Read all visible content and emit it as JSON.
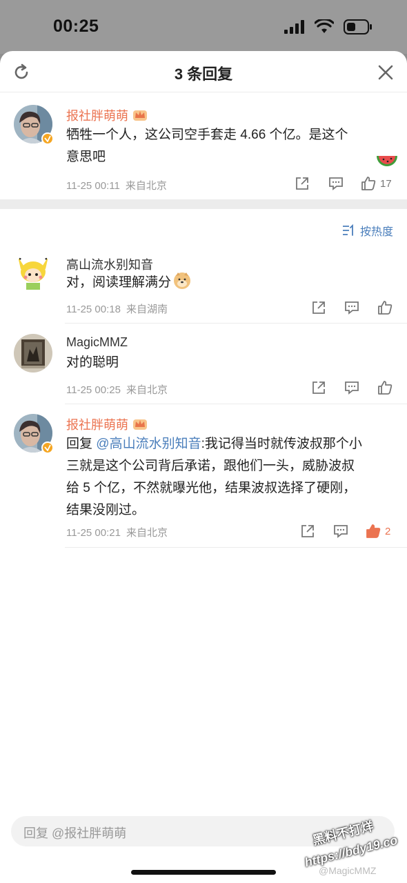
{
  "status": {
    "time": "00:25"
  },
  "header": {
    "title": "3 条回复"
  },
  "root": {
    "username": "报社胖萌萌",
    "content_line1": "牺牲一个人，这公司空手套走 4.66 个亿。是这个",
    "content_line2": "意思吧",
    "time": "11-25 00:11",
    "location": "来自北京",
    "likes": "17"
  },
  "sort": {
    "label": "按热度"
  },
  "replies": [
    {
      "username": "高山流水别知音",
      "content": "对，阅读理解满分",
      "time": "11-25 00:18",
      "location": "来自湖南"
    },
    {
      "username": "MagicMMZ",
      "content": "对的聪明",
      "time": "11-25 00:25",
      "location": "来自北京"
    },
    {
      "username": "报社胖萌萌",
      "reply_prefix": "回复 ",
      "mention": "@高山流水别知音",
      "content_line1": ":我记得当时就传波叔那个小",
      "content_line2": "三就是这个公司背后承诺，跟他们一头，威胁波叔",
      "content_line3": "给 5 个亿，不然就曝光他，结果波叔选择了硬刚，",
      "content_line4": "结果没刚过。",
      "time": "11-25 00:21",
      "location": "来自北京",
      "likes": "2"
    }
  ],
  "input": {
    "placeholder": "回复 @报社胖萌萌"
  },
  "watermark": {
    "line1": "黑料不打烊",
    "line2": "https://bdy19.co",
    "weibo": "@MagicMMZ"
  },
  "colors": {
    "accent": "#eb7350",
    "link": "#4a7ebb",
    "vip": "#f5a623"
  },
  "icons": [
    "refresh-icon",
    "close-icon",
    "share-icon",
    "comment-icon",
    "like-icon",
    "crown-icon",
    "sort-icon",
    "watermelon-emoji",
    "doge-emoji"
  ]
}
